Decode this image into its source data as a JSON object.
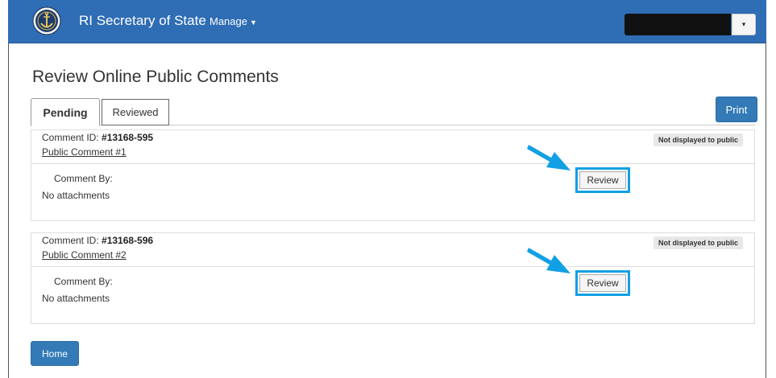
{
  "navbar": {
    "brand": "RI Secretary of State",
    "manage_label": "Manage",
    "user_dropdown_caret": "▾"
  },
  "page": {
    "title": "Review Online Public Comments",
    "print_label": "Print",
    "home_label": "Home"
  },
  "tabs": [
    {
      "label": "Pending",
      "active": true
    },
    {
      "label": "Reviewed",
      "active": false
    }
  ],
  "comments": [
    {
      "id_prefix": "Comment ID: ",
      "id": "#13168-595",
      "title": "Public Comment #1",
      "badge": "Not displayed to public",
      "comment_by_label": "Comment By:",
      "attachments": "No attachments",
      "review_label": "Review"
    },
    {
      "id_prefix": "Comment ID: ",
      "id": "#13168-596",
      "title": "Public Comment #2",
      "badge": "Not displayed to public",
      "comment_by_label": "Comment By:",
      "attachments": "No attachments",
      "review_label": "Review"
    }
  ],
  "colors": {
    "navbar": "#2f6db4",
    "primary_button": "#337ab7",
    "highlight": "#12a0e4"
  },
  "icons": {
    "logo": "anchor-seal-icon",
    "annotation": "arrow-pointer-icon"
  }
}
